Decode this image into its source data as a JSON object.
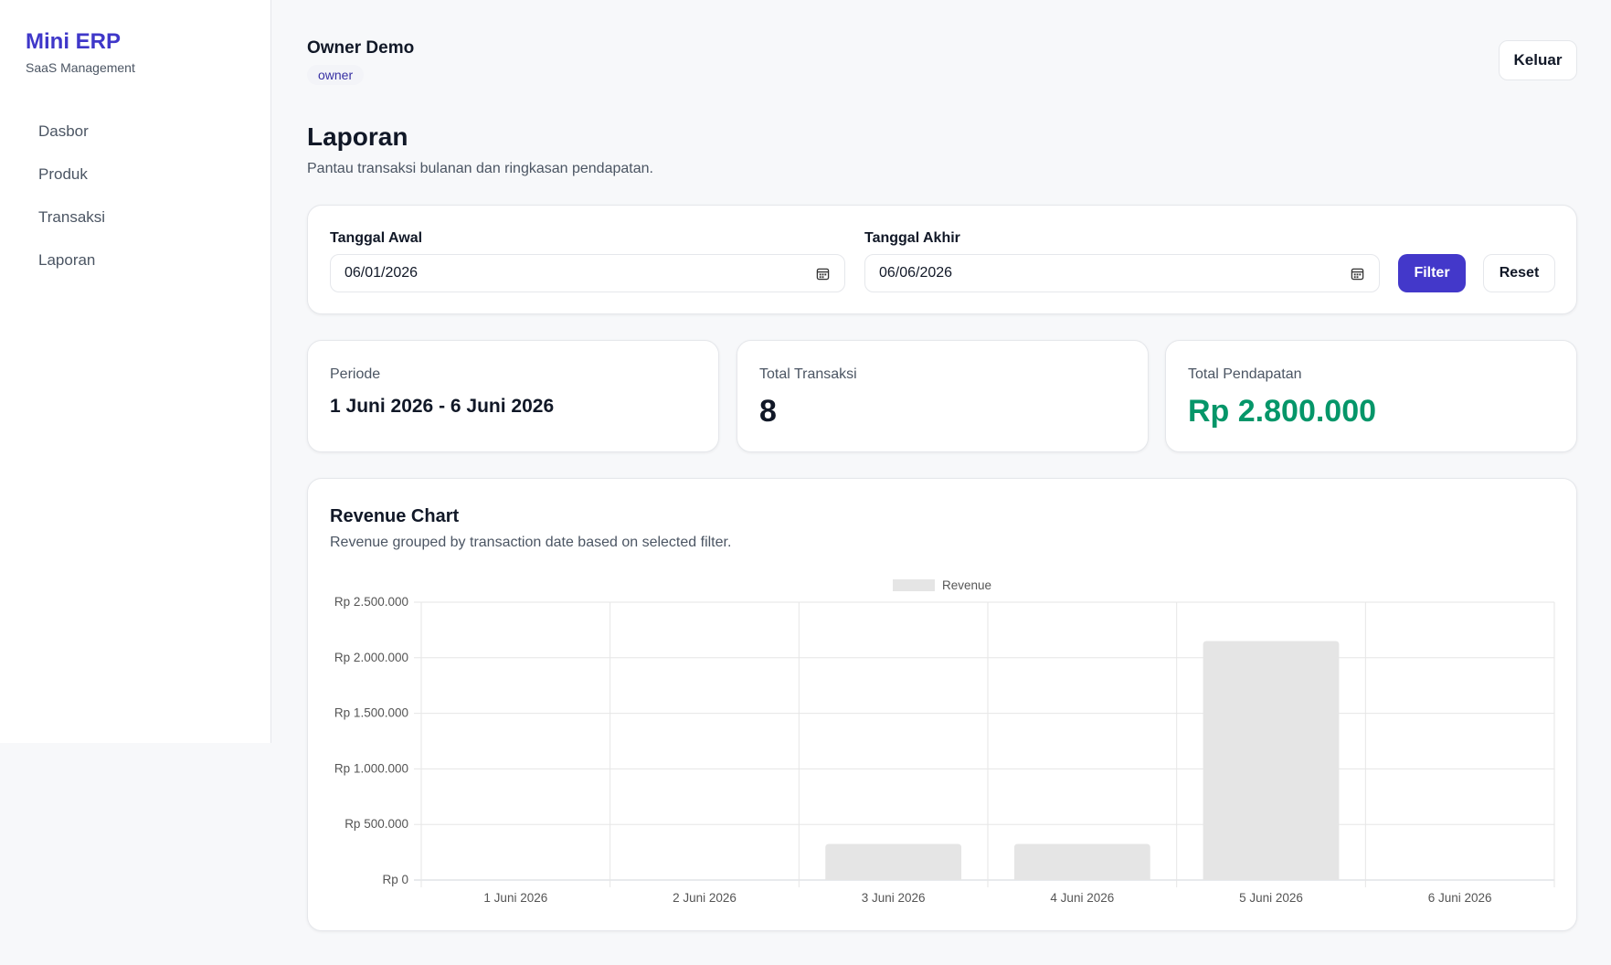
{
  "sidebar": {
    "brand_title": "Mini ERP",
    "brand_sub": "SaaS Management",
    "items": [
      {
        "label": "Dasbor"
      },
      {
        "label": "Produk"
      },
      {
        "label": "Transaksi"
      },
      {
        "label": "Laporan"
      }
    ]
  },
  "header": {
    "user_name": "Owner Demo",
    "role": "owner",
    "logout_label": "Keluar"
  },
  "page": {
    "title": "Laporan",
    "subtitle": "Pantau transaksi bulanan dan ringkasan pendapatan."
  },
  "filter": {
    "start_label": "Tanggal Awal",
    "start_value": "06/01/2026",
    "end_label": "Tanggal Akhir",
    "end_value": "06/06/2026",
    "filter_label": "Filter",
    "reset_label": "Reset"
  },
  "stats": {
    "period_label": "Periode",
    "period_value": "1 Juni 2026 - 6 Juni 2026",
    "transactions_label": "Total Transaksi",
    "transactions_value": "8",
    "revenue_label": "Total Pendapatan",
    "revenue_value": "Rp 2.800.000"
  },
  "chart": {
    "title": "Revenue Chart",
    "subtitle": "Revenue grouped by transaction date based on selected filter."
  },
  "colors": {
    "accent": "#4338ca",
    "brand": "#3f37c9",
    "positive": "#059669",
    "bar": "#e5e5e5"
  },
  "chart_data": {
    "type": "bar",
    "categories": [
      "1 Juni 2026",
      "2 Juni 2026",
      "3 Juni 2026",
      "4 Juni 2026",
      "5 Juni 2026",
      "6 Juni 2026"
    ],
    "series": [
      {
        "name": "Revenue",
        "values": [
          0,
          0,
          325000,
          325000,
          2150000,
          0
        ]
      }
    ],
    "ylim": [
      0,
      2500000
    ],
    "yticks": [
      "Rp 0",
      "Rp 500.000",
      "Rp 1.000.000",
      "Rp 1.500.000",
      "Rp 2.000.000",
      "Rp 2.500.000"
    ],
    "ytick_values": [
      0,
      500000,
      1000000,
      1500000,
      2000000,
      2500000
    ],
    "legend_position": "top",
    "grid": true
  }
}
